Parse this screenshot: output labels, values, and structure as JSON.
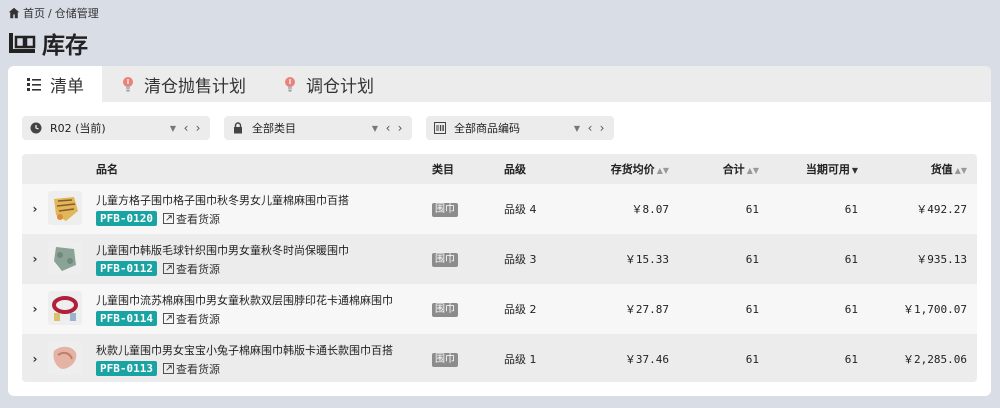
{
  "breadcrumb": {
    "home": "首页",
    "sep": "/",
    "current": "仓储管理"
  },
  "page_title": "库存",
  "tabs": [
    {
      "label": "清单",
      "icon": "list-icon",
      "active": true
    },
    {
      "label": "清仓抛售计划",
      "icon": "lightbulb-icon",
      "active": false
    },
    {
      "label": "调仓计划",
      "icon": "lightbulb-icon",
      "active": false
    }
  ],
  "filters": [
    {
      "icon": "clock-icon",
      "value": "R02 (当前)"
    },
    {
      "icon": "lock-icon",
      "value": "全部类目"
    },
    {
      "icon": "barcode-icon",
      "value": "全部商品编码"
    }
  ],
  "columns": {
    "name": "品名",
    "category": "类目",
    "grade": "品级",
    "avg_cost": "存货均价",
    "total": "合计",
    "available": "当期可用",
    "value": "货值"
  },
  "rows": [
    {
      "name": "儿童方格子围巾格子围巾秋冬男女儿童棉麻围巾百搭",
      "sku": "PFB-0120",
      "source_label": "查看货源",
      "category": "围巾",
      "grade": "品级 4",
      "avg_cost": "￥8.07",
      "total": "61",
      "available": "61",
      "value": "￥492.27"
    },
    {
      "name": "儿童围巾韩版毛球针织围巾男女童秋冬时尚保暖围巾",
      "sku": "PFB-0112",
      "source_label": "查看货源",
      "category": "围巾",
      "grade": "品级 3",
      "avg_cost": "￥15.33",
      "total": "61",
      "available": "61",
      "value": "￥935.13"
    },
    {
      "name": "儿童围巾流苏棉麻围巾男女童秋款双层围脖印花卡通棉麻围巾",
      "sku": "PFB-0114",
      "source_label": "查看货源",
      "category": "围巾",
      "grade": "品级 2",
      "avg_cost": "￥27.87",
      "total": "61",
      "available": "61",
      "value": "￥1,700.07"
    },
    {
      "name": "秋款儿童围巾男女宝宝小兔子棉麻围巾韩版卡通长款围巾百搭",
      "sku": "PFB-0113",
      "source_label": "查看货源",
      "category": "围巾",
      "grade": "品级 1",
      "avg_cost": "￥37.46",
      "total": "61",
      "available": "61",
      "value": "￥2,285.06"
    }
  ],
  "colors": {
    "accent": "#1aa3a3",
    "badge": "#8c8c8c",
    "background": "#d8dde6"
  }
}
